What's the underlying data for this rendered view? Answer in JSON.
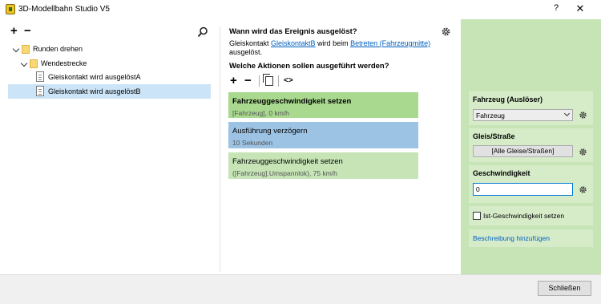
{
  "window": {
    "title": "3D-Modellbahn Studio V5",
    "help_label": "?",
    "close_label": "✕"
  },
  "tree": {
    "add_label": "+",
    "remove_label": "−",
    "search_icon": "search-icon",
    "items": [
      {
        "label": "Runden drehen",
        "type": "folder",
        "level": 0,
        "expanded": true
      },
      {
        "label": "Wendestrecke",
        "type": "folder",
        "level": 1,
        "expanded": true
      },
      {
        "label": "Gleiskontakt wird ausgelöstA",
        "type": "document",
        "level": 2
      },
      {
        "label": "Gleiskontakt wird ausgelöstB",
        "type": "document",
        "level": 2,
        "selected": true
      }
    ]
  },
  "event": {
    "question": "Wann wird das Ereignis ausgelöst?",
    "text_prefix": "Gleiskontakt ",
    "link_contact": "GleiskontaktB",
    "text_middle": " wird beim ",
    "link_trigger": "Betreten (Fahrzeugmitte)",
    "text_suffix": "ausgelöst."
  },
  "actions": {
    "question": "Welche Aktionen sollen ausgeführt werden?",
    "add_label": "+",
    "remove_label": "−",
    "code_label": "<>",
    "items": [
      {
        "title": "Fahrzeuggeschwindigkeit setzen",
        "subtitle": "[Fahrzeug], 0 km/h",
        "color": "#a9d98f",
        "bold": true
      },
      {
        "title": "Ausführung verzögern",
        "subtitle": "10 Sekunden",
        "color": "#9cc3e4",
        "bold": false
      },
      {
        "title": "Fahrzeuggeschwindigkeit setzen",
        "subtitle": "([Fahrzeug].Umspannlok), 75 km/h",
        "color": "#c6e4b6",
        "bold": false
      }
    ]
  },
  "properties": {
    "vehicle_label": "Fahrzeug (Auslöser)",
    "vehicle_value": "Fahrzeug",
    "track_label": "Gleis/Straße",
    "track_value": "[Alle Gleise/Straßen]",
    "speed_label": "Geschwindigkeit",
    "speed_value": "0",
    "actual_speed_label": "Ist-Geschwindigkeit setzen",
    "description_link": "Beschreibung hinzufügen"
  },
  "footer": {
    "close_label": "Schließen"
  },
  "colors": {
    "selected_bg": "#cce4f7",
    "panel_green": "#c6e4b6",
    "link_blue": "#0060c0"
  }
}
